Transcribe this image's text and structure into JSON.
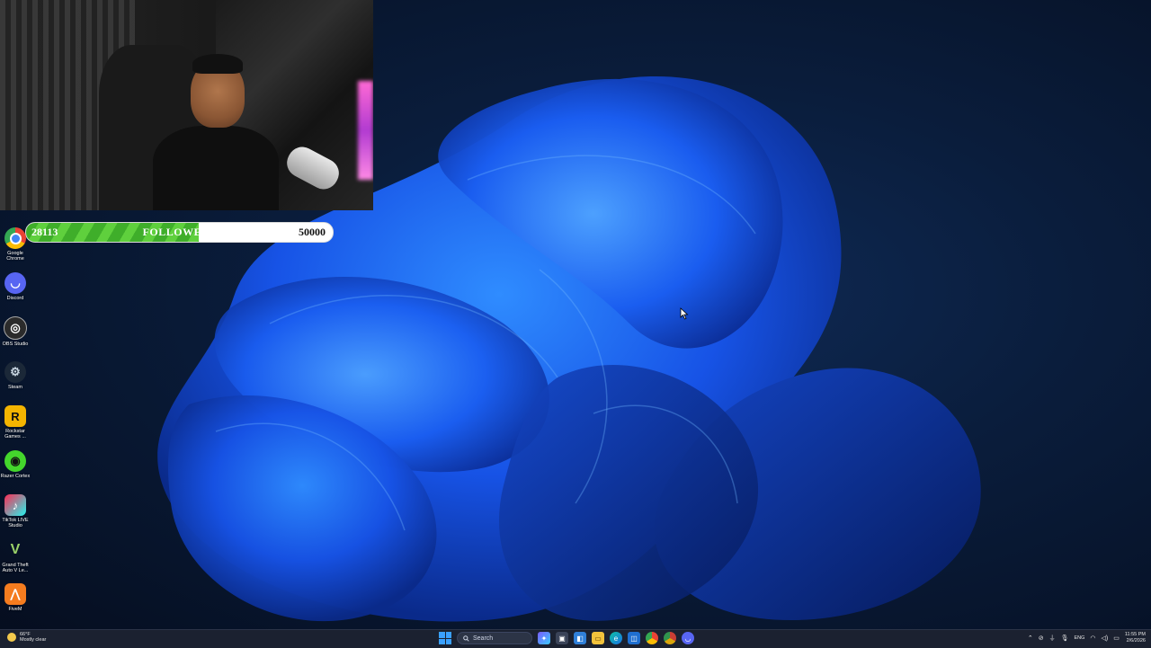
{
  "overlay": {
    "goal": {
      "current": "28113",
      "label": "FOLLOWERS",
      "target": "50000",
      "progress_fraction": 0.5623
    }
  },
  "desktop": {
    "icons": [
      {
        "name": "Google Chrome",
        "icon": "chrome-icon",
        "color": "#e84335"
      },
      {
        "name": "Discord",
        "icon": "discord-icon",
        "color": "#5865f2"
      },
      {
        "name": "OBS Studio",
        "icon": "obs-icon",
        "color": "#2b2b2b"
      },
      {
        "name": "Steam",
        "icon": "steam-icon",
        "color": "#1b2838"
      },
      {
        "name": "Rockstar Games ...",
        "icon": "rockstar-icon",
        "color": "#f4b400"
      },
      {
        "name": "Razer Cortex",
        "icon": "razer-icon",
        "color": "#44d62c"
      },
      {
        "name": "TikTok LIVE Studio",
        "icon": "tiktok-icon",
        "color": "#fe2c55"
      },
      {
        "name": "Grand Theft Auto V Le...",
        "icon": "gta-icon",
        "color": "#3d7a2c"
      },
      {
        "name": "FiveM",
        "icon": "fivem-icon",
        "color": "#f57c1f"
      }
    ]
  },
  "taskbar": {
    "weather": {
      "temp": "66°F",
      "condition": "Mostly clear"
    },
    "search_label": "Search",
    "language": "ENG",
    "time": "11:55 PM",
    "date": "2/6/2026"
  }
}
